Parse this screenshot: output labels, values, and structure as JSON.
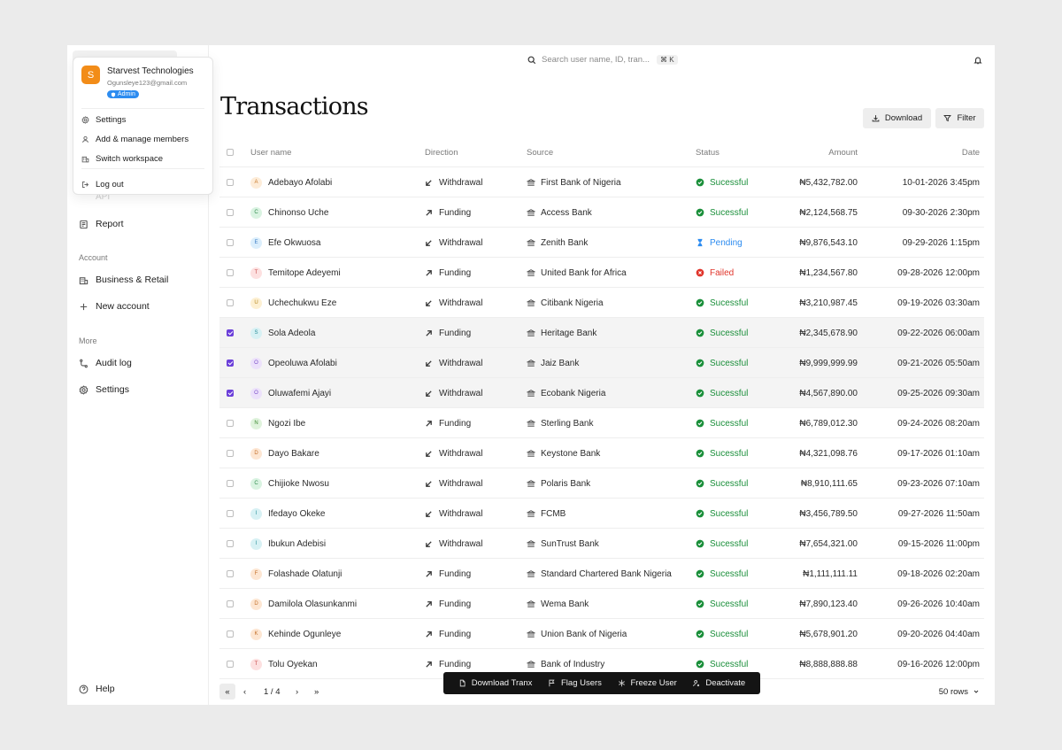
{
  "workspace": {
    "avatar_letter": "S",
    "name": "Starvest Technologies",
    "email": "Ogunsleye123@gmail.com",
    "role_badge": "Admin"
  },
  "account_menu": {
    "items": [
      {
        "label": "Settings",
        "icon": "gear-icon"
      },
      {
        "label": "Add & manage members",
        "icon": "user-icon"
      },
      {
        "label": "Switch workspace",
        "icon": "building-icon"
      },
      {
        "label": "Log out",
        "icon": "logout-icon"
      }
    ]
  },
  "sidebar": {
    "api_label": "API",
    "report_label": "Report",
    "account_group": "Account",
    "business_label": "Business & Retail",
    "new_account_label": "New account",
    "more_group": "More",
    "audit_label": "Audit log",
    "settings_label": "Settings",
    "help_label": "Help"
  },
  "header": {
    "search_placeholder": "Search user name, ID, tran...",
    "search_shortcut": "⌘ K",
    "title": "Transactions",
    "download_label": "Download",
    "filter_label": "Filter"
  },
  "table": {
    "columns": {
      "user": "User name",
      "direction": "Direction",
      "source": "Source",
      "status": "Status",
      "amount": "Amount",
      "date": "Date"
    },
    "rows": [
      {
        "initial": "A",
        "name": "Adebayo Afolabi",
        "direction": "Withdrawal",
        "source": "First Bank of Nigeria",
        "status": "Sucessful",
        "amount": "₦5,432,782.00",
        "date": "10-01-2026 3:45pm",
        "selected": false
      },
      {
        "initial": "C",
        "name": "Chinonso Uche",
        "direction": "Funding",
        "source": "Access Bank",
        "status": "Sucessful",
        "amount": "₦2,124,568.75",
        "date": "09-30-2026 2:30pm",
        "selected": false
      },
      {
        "initial": "E",
        "name": "Efe Okwuosa",
        "direction": "Withdrawal",
        "source": "Zenith Bank",
        "status": "Pending",
        "amount": "₦9,876,543.10",
        "date": "09-29-2026 1:15pm",
        "selected": false
      },
      {
        "initial": "T",
        "name": "Temitope Adeyemi",
        "direction": "Funding",
        "source": "United Bank for Africa",
        "status": "Failed",
        "amount": "₦1,234,567.80",
        "date": "09-28-2026 12:00pm",
        "selected": false
      },
      {
        "initial": "U",
        "name": "Uchechukwu Eze",
        "direction": "Withdrawal",
        "source": "Citibank Nigeria",
        "status": "Sucessful",
        "amount": "₦3,210,987.45",
        "date": "09-19-2026 03:30am",
        "selected": false
      },
      {
        "initial": "S",
        "name": "Sola Adeola",
        "direction": "Funding",
        "source": "Heritage Bank",
        "status": "Sucessful",
        "amount": "₦2,345,678.90",
        "date": "09-22-2026 06:00am",
        "selected": true
      },
      {
        "initial": "O",
        "name": "Opeoluwa Afolabi",
        "direction": "Withdrawal",
        "source": "Jaiz Bank",
        "status": "Sucessful",
        "amount": "₦9,999,999.99",
        "date": "09-21-2026 05:50am",
        "selected": true
      },
      {
        "initial": "O",
        "name": "Oluwafemi Ajayi",
        "direction": "Withdrawal",
        "source": "Ecobank Nigeria",
        "status": "Sucessful",
        "amount": "₦4,567,890.00",
        "date": "09-25-2026 09:30am",
        "selected": true
      },
      {
        "initial": "N",
        "name": "Ngozi Ibe",
        "direction": "Funding",
        "source": "Sterling Bank",
        "status": "Sucessful",
        "amount": "₦6,789,012.30",
        "date": "09-24-2026 08:20am",
        "selected": false
      },
      {
        "initial": "D",
        "name": "Dayo Bakare",
        "direction": "Withdrawal",
        "source": "Keystone Bank",
        "status": "Sucessful",
        "amount": "₦4,321,098.76",
        "date": "09-17-2026 01:10am",
        "selected": false
      },
      {
        "initial": "C",
        "name": "Chijioke Nwosu",
        "direction": "Withdrawal",
        "source": "Polaris Bank",
        "status": "Sucessful",
        "amount": "₦8,910,111.65",
        "date": "09-23-2026 07:10am",
        "selected": false
      },
      {
        "initial": "I",
        "name": "Ifedayo Okeke",
        "direction": "Withdrawal",
        "source": "FCMB",
        "status": "Sucessful",
        "amount": "₦3,456,789.50",
        "date": "09-27-2026 11:50am",
        "selected": false
      },
      {
        "initial": "I",
        "name": "Ibukun Adebisi",
        "direction": "Withdrawal",
        "source": "SunTrust Bank",
        "status": "Sucessful",
        "amount": "₦7,654,321.00",
        "date": "09-15-2026 11:00pm",
        "selected": false
      },
      {
        "initial": "F",
        "name": "Folashade Olatunji",
        "direction": "Funding",
        "source": "Standard Chartered Bank Nigeria",
        "status": "Sucessful",
        "amount": "₦1,111,111.11",
        "date": "09-18-2026 02:20am",
        "selected": false
      },
      {
        "initial": "D",
        "name": "Damilola Olasunkanmi",
        "direction": "Funding",
        "source": "Wema Bank",
        "status": "Sucessful",
        "amount": "₦7,890,123.40",
        "date": "09-26-2026 10:40am",
        "selected": false
      },
      {
        "initial": "K",
        "name": "Kehinde Ogunleye",
        "direction": "Funding",
        "source": "Union Bank of Nigeria",
        "status": "Sucessful",
        "amount": "₦5,678,901.20",
        "date": "09-20-2026 04:40am",
        "selected": false
      },
      {
        "initial": "T",
        "name": "Tolu Oyekan",
        "direction": "Funding",
        "source": "Bank of Industry",
        "status": "Sucessful",
        "amount": "₦8,888,888.88",
        "date": "09-16-2026 12:00pm",
        "selected": false
      }
    ]
  },
  "pagination": {
    "first": "«",
    "prev": "‹",
    "page": "1 / 4",
    "next": "›",
    "last": "»",
    "rows_per_page": "50 rows"
  },
  "bulk_actions": [
    {
      "label": "Download Tranx",
      "icon": "file-icon"
    },
    {
      "label": "Flag Users",
      "icon": "flag-icon"
    },
    {
      "label": "Freeze User",
      "icon": "snowflake-icon"
    },
    {
      "label": "Deactivate",
      "icon": "user-off-icon"
    }
  ],
  "colors": {
    "accent": "#6b3fd9",
    "success": "#1a8f3a",
    "pending": "#2d8cf0",
    "failed": "#e0342a",
    "workspace_avatar": "#f28c18",
    "badge": "#2d8cf0"
  }
}
